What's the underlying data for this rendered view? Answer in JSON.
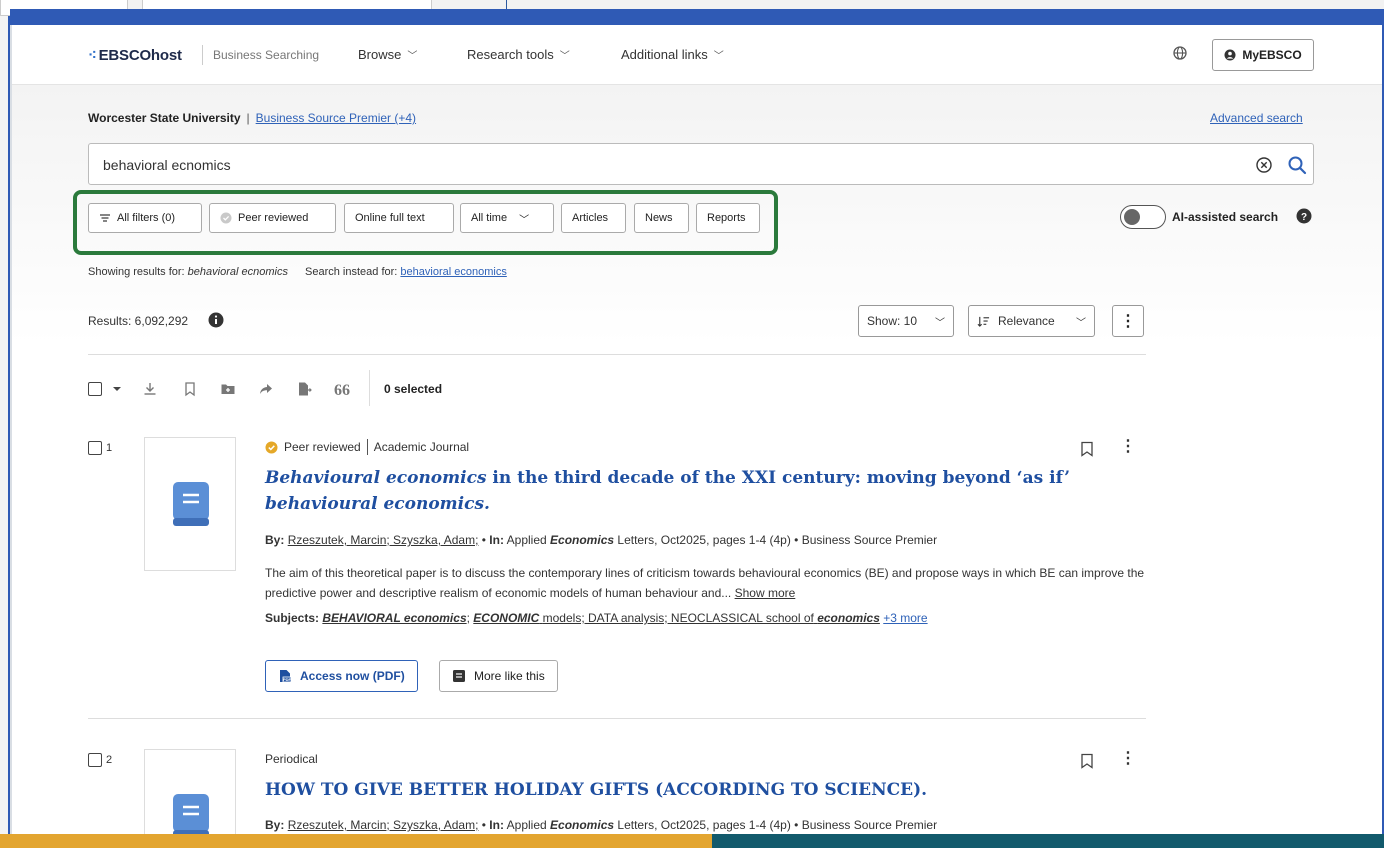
{
  "header": {
    "logo_text": "EBSCOhost",
    "subtitle": "Business Searching",
    "nav": [
      {
        "label": "Browse"
      },
      {
        "label": "Research tools"
      },
      {
        "label": "Additional links"
      }
    ],
    "account_label": "MyEBSCO"
  },
  "search": {
    "institution": "Worcester State University",
    "databases_link": "Business Source Premier (+4)",
    "advanced_link": "Advanced search",
    "query": "behavioral ecnomics"
  },
  "filters": {
    "all_filters": "All filters (0)",
    "peer_reviewed": "Peer reviewed",
    "online_full_text": "Online full text",
    "all_time": "All time",
    "articles": "Articles",
    "news": "News",
    "reports": "Reports",
    "ai_toggle_label": "AI-assisted search",
    "ai_enabled": false
  },
  "correction": {
    "showing_prefix": "Showing results for:",
    "showing_term": "behavioral ecnomics",
    "instead_prefix": "Search instead for:",
    "instead_term": "behavioral economics"
  },
  "results_bar": {
    "results_label": "Results: 6,092,292",
    "show_label": "Show: 10",
    "sort_label": "Relevance",
    "selected_label": "0 selected"
  },
  "results": [
    {
      "number": "1",
      "peer_reviewed": "Peer reviewed",
      "type": "Academic Journal",
      "title_emph": "Behavioural economics",
      "title_mid": " in the third decade of the XXI century: moving beyond ‘as if’ ",
      "title_end": "behavioural economics.",
      "by_label": "By:",
      "authors": "Rzeszutek, Marcin; Szyszka, Adam;",
      "in_label": "In:",
      "source_pre": "Applied",
      "source_emph": "Economics",
      "source_post": "Letters, Oct2025, pages 1-4 (4p)",
      "database": "Business Source Premier",
      "abstract": "The aim of this theoretical paper is to discuss the contemporary lines of criticism towards behavioural economics (BE) and propose ways in which BE can improve the predictive power and descriptive realism of economic models of human behaviour and...",
      "show_more": "Show more",
      "subjects_label": "Subjects:",
      "subj1": "BEHAVIORAL economics",
      "subj2": "ECONOMIC",
      "subj2_post": "models; DATA analysis; NEOCLASSICAL school of",
      "subj3": "economics",
      "subj_more": "+3 more",
      "access_label": "Access now (PDF)",
      "more_like_label": "More like this"
    },
    {
      "number": "2",
      "type": "Periodical",
      "title": "HOW TO GIVE BETTER HOLIDAY GIFTS (ACCORDING TO SCIENCE).",
      "by_label": "By:",
      "authors": "Rzeszutek, Marcin; Szyszka, Adam;",
      "in_label": "In:",
      "source_pre": "Applied",
      "source_emph": "Economics",
      "source_post": "Letters, Oct2025, pages 1-4 (4p)",
      "database": "Business Source Premier"
    }
  ],
  "colors": {
    "link": "#2f62b8",
    "title": "#1f4fa0",
    "highlight_box": "#2b7a3c",
    "slide_blue": "#2f5ab5",
    "slide_orange": "#e3a530",
    "slide_teal": "#125a6c"
  }
}
